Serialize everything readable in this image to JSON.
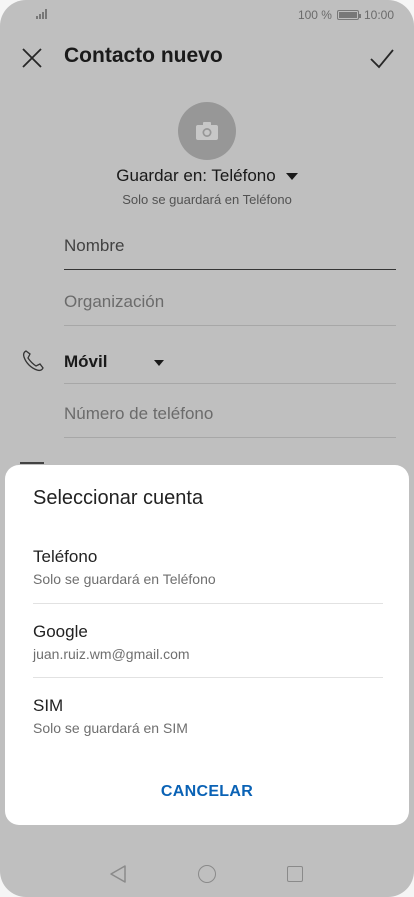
{
  "status_bar": {
    "battery": "100 %",
    "time": "10:00"
  },
  "app_bar": {
    "title": "Contacto nuevo"
  },
  "form": {
    "save_in_label": "Guardar en: Teléfono",
    "save_in_sub": "Solo se guardará en Teléfono",
    "name_placeholder": "Nombre",
    "org_placeholder": "Organización",
    "phone_type": "Móvil",
    "phone_placeholder": "Número de teléfono"
  },
  "dialog": {
    "title": "Seleccionar cuenta",
    "options": [
      {
        "title": "Teléfono",
        "subtitle": "Solo se guardará en Teléfono"
      },
      {
        "title": "Google",
        "subtitle": "juan.ruiz.wm@gmail.com"
      },
      {
        "title": "SIM",
        "subtitle": "Solo se guardará en SIM"
      }
    ],
    "cancel_label": "CANCELAR"
  },
  "colors": {
    "accent": "#0a62b5",
    "background": "#f5f5f5"
  },
  "icons": [
    "signal-icon",
    "battery-icon",
    "close-icon",
    "check-icon",
    "camera-icon",
    "phone-icon",
    "back-icon",
    "home-icon",
    "recents-icon"
  ]
}
